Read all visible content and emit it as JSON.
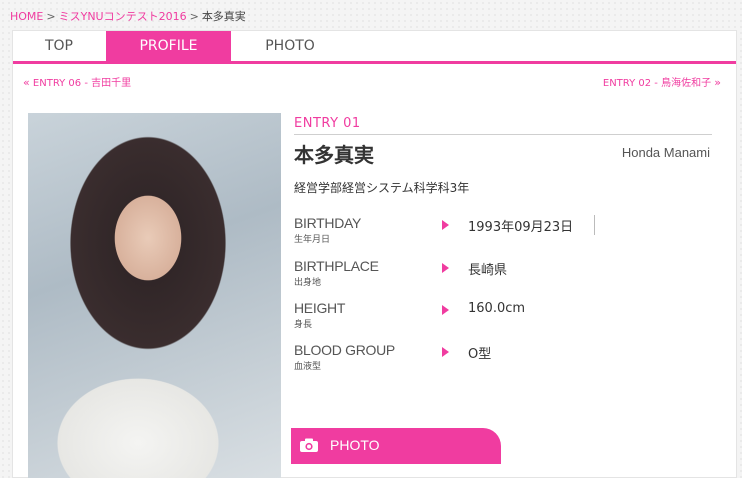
{
  "breadcrumb": {
    "home": "HOME",
    "contest": "ミスYNUコンテスト2016",
    "current": "本多真実",
    "separator": ">"
  },
  "tabs": [
    {
      "label": "TOP",
      "active": false
    },
    {
      "label": "PROFILE",
      "active": true
    },
    {
      "label": "PHOTO",
      "active": false
    }
  ],
  "nav": {
    "prev_arrow": "«",
    "prev_entry": "ENTRY 06",
    "prev_dash": " - ",
    "prev_name": "吉田千里",
    "next_entry": "ENTRY 02",
    "next_dash": " - ",
    "next_name": "鳥海佐和子",
    "next_arrow": "»"
  },
  "profile": {
    "entry": "ENTRY 01",
    "name_ja": "本多真実",
    "name_en": "Honda Manami",
    "department": "経営学部経営システム科学科3年",
    "fields": [
      {
        "label_en": "BIRTHDAY",
        "label_ja": "生年月日",
        "value": "1993年09月23日"
      },
      {
        "label_en": "BIRTHPLACE",
        "label_ja": "出身地",
        "value": "長崎県"
      },
      {
        "label_en": "HEIGHT",
        "label_ja": "身長",
        "value": "160.0cm"
      },
      {
        "label_en": "BLOOD GROUP",
        "label_ja": "血液型",
        "value": "O型"
      }
    ]
  },
  "photo_button": {
    "label": "PHOTO",
    "icon": "camera-icon"
  },
  "colors": {
    "accent": "#f03ca0",
    "text": "#333333"
  }
}
